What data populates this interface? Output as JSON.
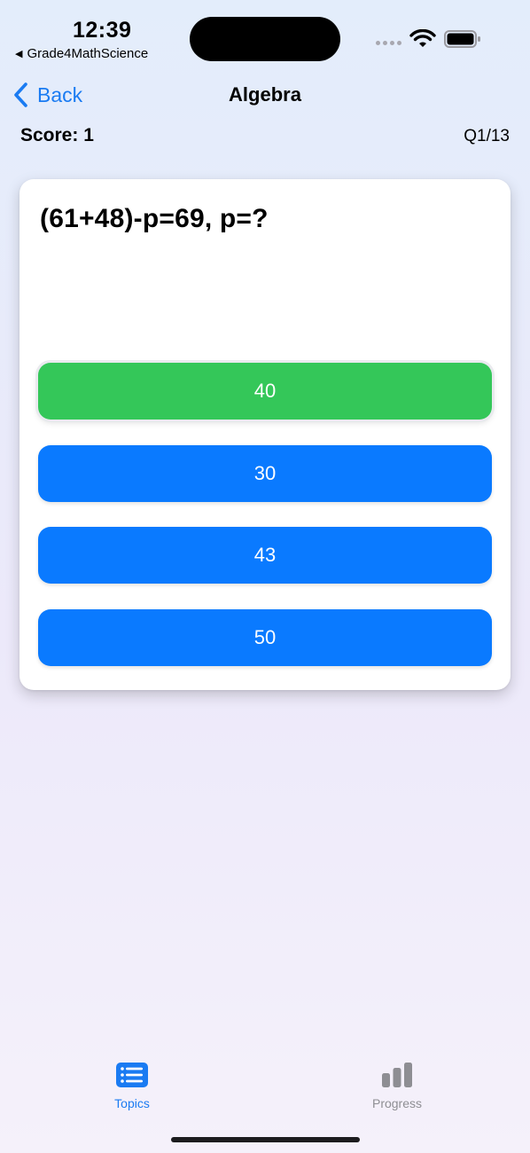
{
  "status_bar": {
    "time": "12:39",
    "back_app_label": "Grade4MathScience",
    "back_app_arrow": "◀",
    "icons": [
      "signal-icon",
      "wifi-icon",
      "battery-icon"
    ]
  },
  "nav": {
    "back_label": "Back",
    "title": "Algebra"
  },
  "quiz": {
    "score_label": "Score: 1",
    "question_counter": "Q1/13",
    "question": "(61+48)-p=69, p=?",
    "answers": [
      {
        "label": "40",
        "state": "correct"
      },
      {
        "label": "30",
        "state": "default"
      },
      {
        "label": "43",
        "state": "default"
      },
      {
        "label": "50",
        "state": "default"
      }
    ]
  },
  "tab_bar": {
    "items": [
      {
        "label": "Topics",
        "icon": "list-icon",
        "selected": true
      },
      {
        "label": "Progress",
        "icon": "bar-chart-icon",
        "selected": false
      }
    ]
  },
  "colors": {
    "accent": "#1a7bf2",
    "answer_default": "#0a7aff",
    "answer_correct": "#34c759",
    "tab_inactive": "#8e8e93"
  }
}
